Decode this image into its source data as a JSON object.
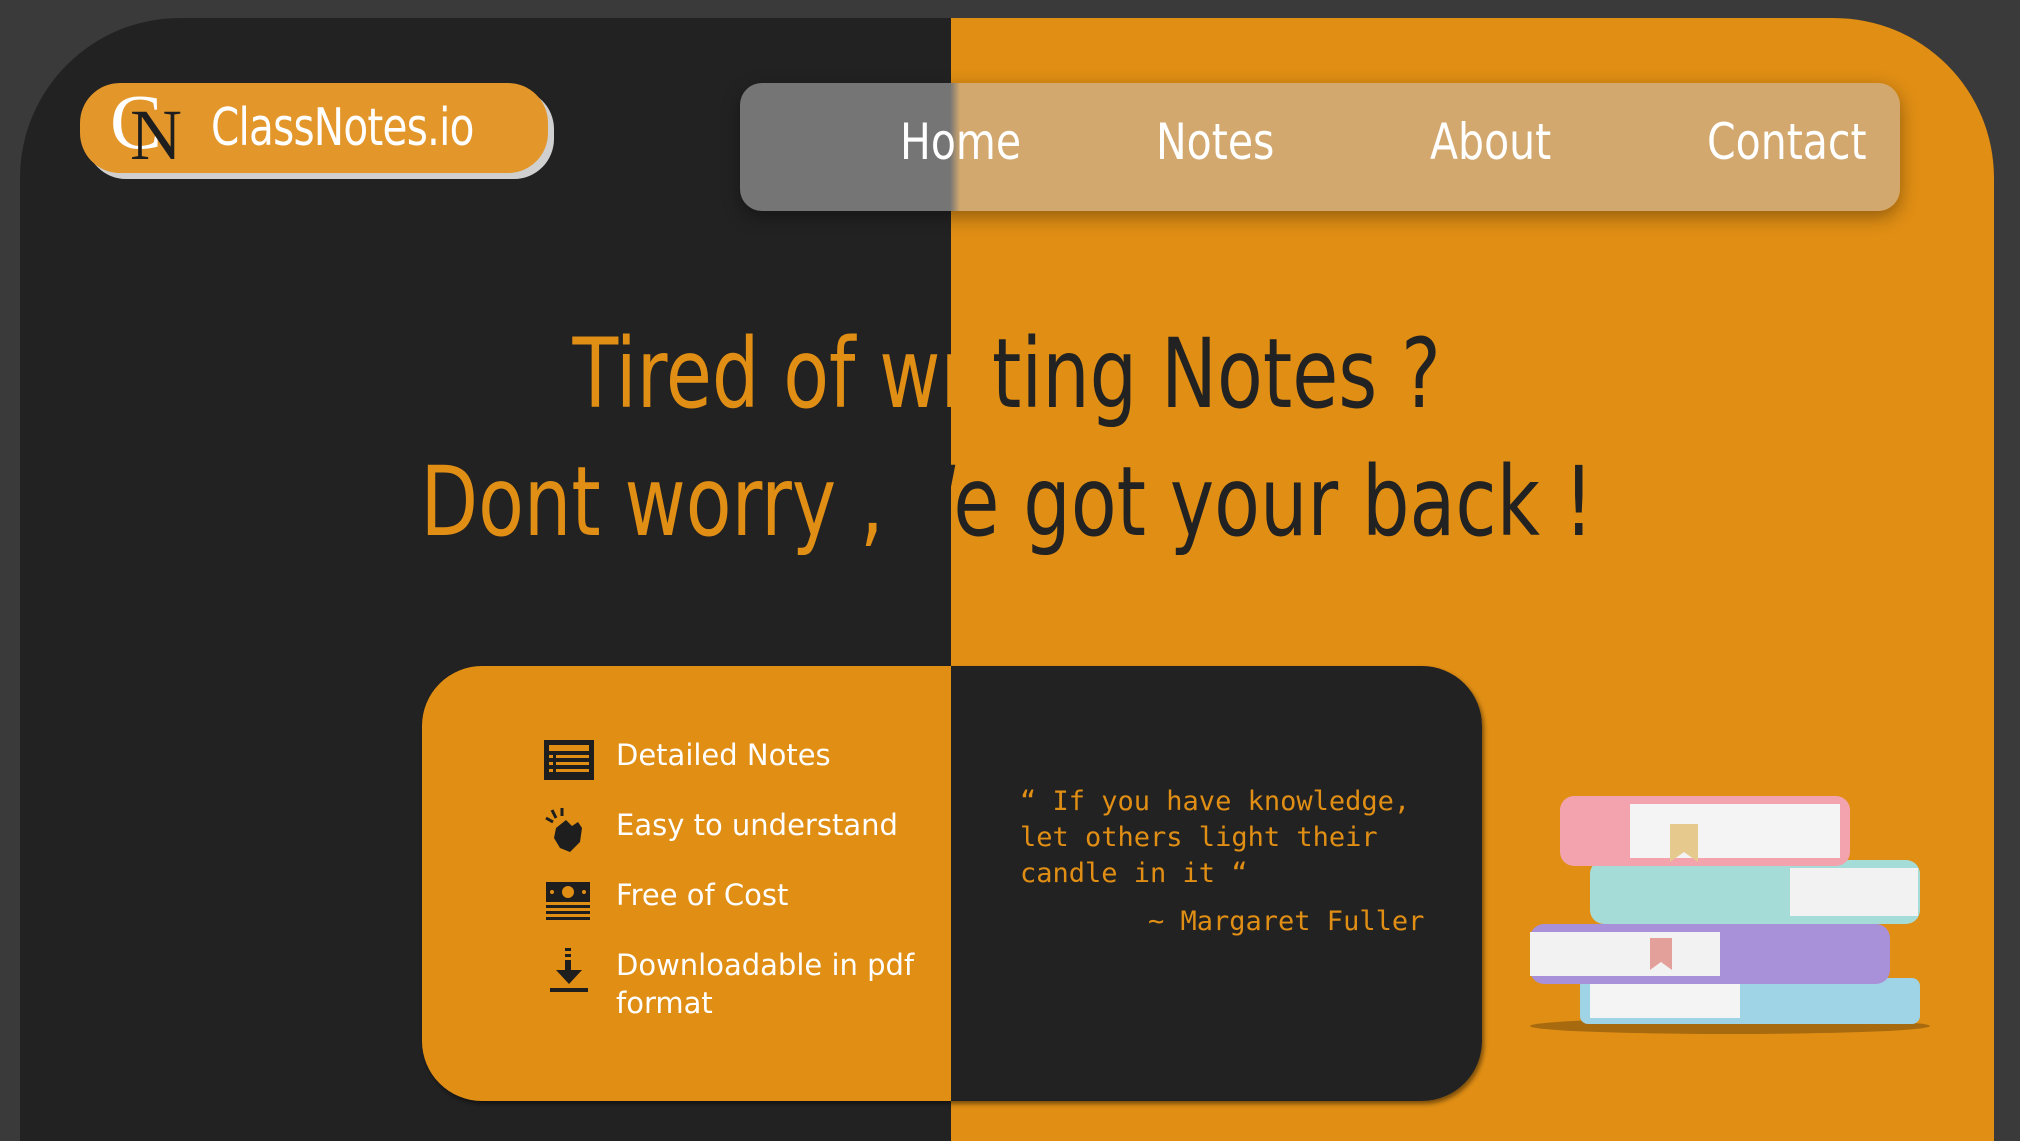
{
  "brand": {
    "logo_initials_c": "C",
    "logo_initials_n": "N",
    "name": "ClassNotes.io"
  },
  "nav": {
    "items": [
      "Home",
      "Notes",
      "About",
      "Contact"
    ]
  },
  "hero": {
    "line1_orange": "Tired of wri",
    "line1_dark": "ting Notes ?",
    "line2_orange": "Dont worry ,",
    "line2_dark": "We got your back !"
  },
  "features": [
    {
      "icon": "notes-list-icon",
      "label": "Detailed Notes"
    },
    {
      "icon": "snap-hand-icon",
      "label": "Easy to understand"
    },
    {
      "icon": "money-bills-icon",
      "label": "Free of Cost"
    },
    {
      "icon": "download-icon",
      "label": "Downloadable in pdf format"
    }
  ],
  "quote": {
    "text": "“ If you have knowledge, let others light their candle in it “",
    "author": "~ Margaret Fuller"
  },
  "colors": {
    "accent": "#e08e14",
    "dark": "#222222",
    "background": "#3a3a3a"
  }
}
